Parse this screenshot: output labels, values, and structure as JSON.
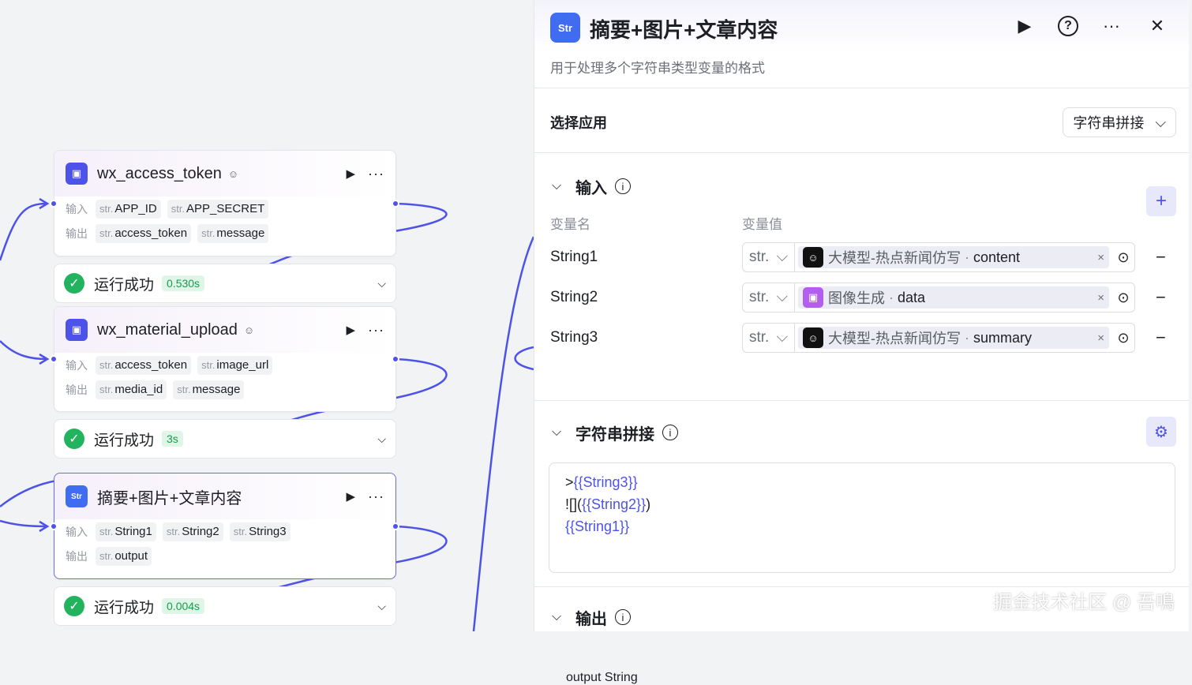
{
  "canvas": {
    "nodes": [
      {
        "title": "wx_access_token",
        "badge": "☺",
        "input_label": "输入",
        "output_label": "输出",
        "inputs": [
          {
            "type": "str.",
            "name": "APP_ID"
          },
          {
            "type": "str.",
            "name": "APP_SECRET"
          }
        ],
        "outputs": [
          {
            "type": "str.",
            "name": "access_token"
          },
          {
            "type": "str.",
            "name": "message"
          }
        ],
        "status": "运行成功",
        "time": "0.530s"
      },
      {
        "title": "wx_material_upload",
        "badge": "☺",
        "input_label": "输入",
        "output_label": "输出",
        "inputs": [
          {
            "type": "str.",
            "name": "access_token"
          },
          {
            "type": "str.",
            "name": "image_url"
          }
        ],
        "outputs": [
          {
            "type": "str.",
            "name": "media_id"
          },
          {
            "type": "str.",
            "name": "message"
          }
        ],
        "status": "运行成功",
        "time": "3s"
      },
      {
        "title": "摘要+图片+文章内容",
        "input_label": "输入",
        "output_label": "输出",
        "inputs": [
          {
            "type": "str.",
            "name": "String1"
          },
          {
            "type": "str.",
            "name": "String2"
          },
          {
            "type": "str.",
            "name": "String3"
          }
        ],
        "outputs": [
          {
            "type": "str.",
            "name": "output"
          }
        ],
        "status": "运行成功",
        "time": "0.004s"
      }
    ],
    "wire_color": "#4d53e8"
  },
  "panel": {
    "icon_text": "Str",
    "title": "摘要+图片+文章内容",
    "description": "用于处理多个字符串类型变量的格式",
    "app_label": "选择应用",
    "app_value": "字符串拼接",
    "input_section": {
      "title": "输入",
      "col_name": "变量名",
      "col_value": "变量值",
      "rows": [
        {
          "name": "String1",
          "type": "str.",
          "source": "大模型-热点新闻仿写",
          "field": "content"
        },
        {
          "name": "String2",
          "type": "str.",
          "source": "图像生成",
          "field": "data"
        },
        {
          "name": "String3",
          "type": "str.",
          "source": "大模型-热点新闻仿写",
          "field": "summary"
        }
      ]
    },
    "concat_section": {
      "title": "字符串拼接",
      "line1_prefix": ">",
      "line1_var": "{{String3}}",
      "line2_prefix": "![](",
      "line2_var": "{{String2}}",
      "line2_suffix": ")",
      "line3_var": "{{String1}}"
    },
    "output_section": {
      "title": "输出",
      "partial_text": "output  String"
    }
  },
  "watermark": "掘金技术社区 @ 吾鳴"
}
